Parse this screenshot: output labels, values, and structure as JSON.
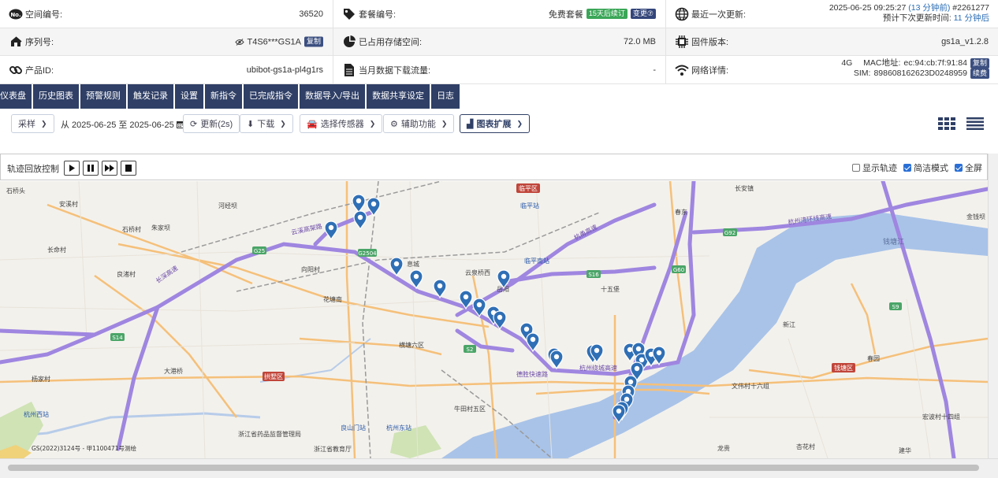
{
  "info": {
    "space_no_label": "空间编号:",
    "space_no": "36520",
    "plan_no_label": "套餐编号:",
    "plan_name": "免费套餐",
    "plan_tag": "15天后续订",
    "plan_btn": "变更⑦",
    "last_update_label": "最近一次更新:",
    "last_update_time": "2025-06-25 09:25:27",
    "last_update_rel": "(13 分钟前)",
    "last_update_id": "#2261277",
    "next_update_prefix": "预计下次更新时间:",
    "next_update": "11 分钟后",
    "serial_label": "序列号:",
    "serial": "T4S6***GS1A",
    "copy_label": "复制",
    "storage_label": "已占用存储空间:",
    "storage": "72.0 MB",
    "firmware_label": "固件版本:",
    "firmware": "gs1a_v1.2.8",
    "product_label": "产品ID:",
    "product_id": "ubibot-gs1a-pl4g1rs",
    "download_label": "当月数据下载流量:",
    "download": "-",
    "network_label": "网络详情:",
    "net_type": "4G",
    "mac_label": "MAC地址:",
    "mac": "ec:94:cb:7f:91:84",
    "mac_copy": "复制",
    "sim_label": "SIM:",
    "sim": "898608162623D0248959",
    "sim_btn": "续费"
  },
  "tabs": [
    "仪表盘",
    "历史图表",
    "预警规则",
    "触发记录",
    "设置",
    "新指令",
    "已完成指令",
    "数据导入/导出",
    "数据共享设定",
    "日志"
  ],
  "toolbar": {
    "sample": "采样",
    "range": "从 2025-06-25 至 2025-06-25",
    "refresh": "更新(2s)",
    "download": "下载",
    "select_sensor": "选择传感器",
    "assist": "辅助功能",
    "chart_ext": "图表扩展"
  },
  "playback": {
    "label": "轨迹回放控制",
    "show_track": "显示轨迹",
    "simple_mode": "简洁模式",
    "fullscreen": "全屏"
  },
  "map_labels": {
    "districts": [
      "临平区",
      "拱墅区",
      "钱塘区"
    ],
    "places": [
      "石桥头",
      "安溪村",
      "河经坝",
      "石桥村",
      "朱家坝",
      "长命村",
      "良渚村",
      "向阳村",
      "息城",
      "云泉桥西",
      "十五堡",
      "花塘南",
      "大港桥",
      "杨家村",
      "横塘六区",
      "牛田村五区",
      "浙江省药品监督管理局",
      "浙江省教育厅",
      "新江",
      "春园",
      "文伟村十六组",
      "宏波村十四组",
      "春东",
      "长安镇",
      "金钱坝",
      "龙贵",
      "杏花村",
      "建华",
      "岳阳"
    ],
    "stations": [
      "临平站",
      "临平南站",
      "杭州西站",
      "良山门站",
      "杭州东站"
    ],
    "roads": [
      "云溪高架路",
      "杭州湾环线高速",
      "杭州绕城高速",
      "杭甬高速",
      "德胜快速路",
      "长深高速",
      "钱塘江",
      "钱塘江大桥"
    ],
    "shields": [
      "G25",
      "G2504",
      "S14",
      "S16",
      "S2",
      "G60",
      "G92",
      "S9"
    ],
    "copyright": "GS(2022)3124号 - 甲1100471号测绘"
  },
  "colors": {
    "nav": "#2f3f66",
    "accent": "#2a6db5",
    "marker": "#2f6fb5",
    "river": "#a9c3e8",
    "highway": "#9f86e0",
    "arterial": "#f5c07a"
  }
}
